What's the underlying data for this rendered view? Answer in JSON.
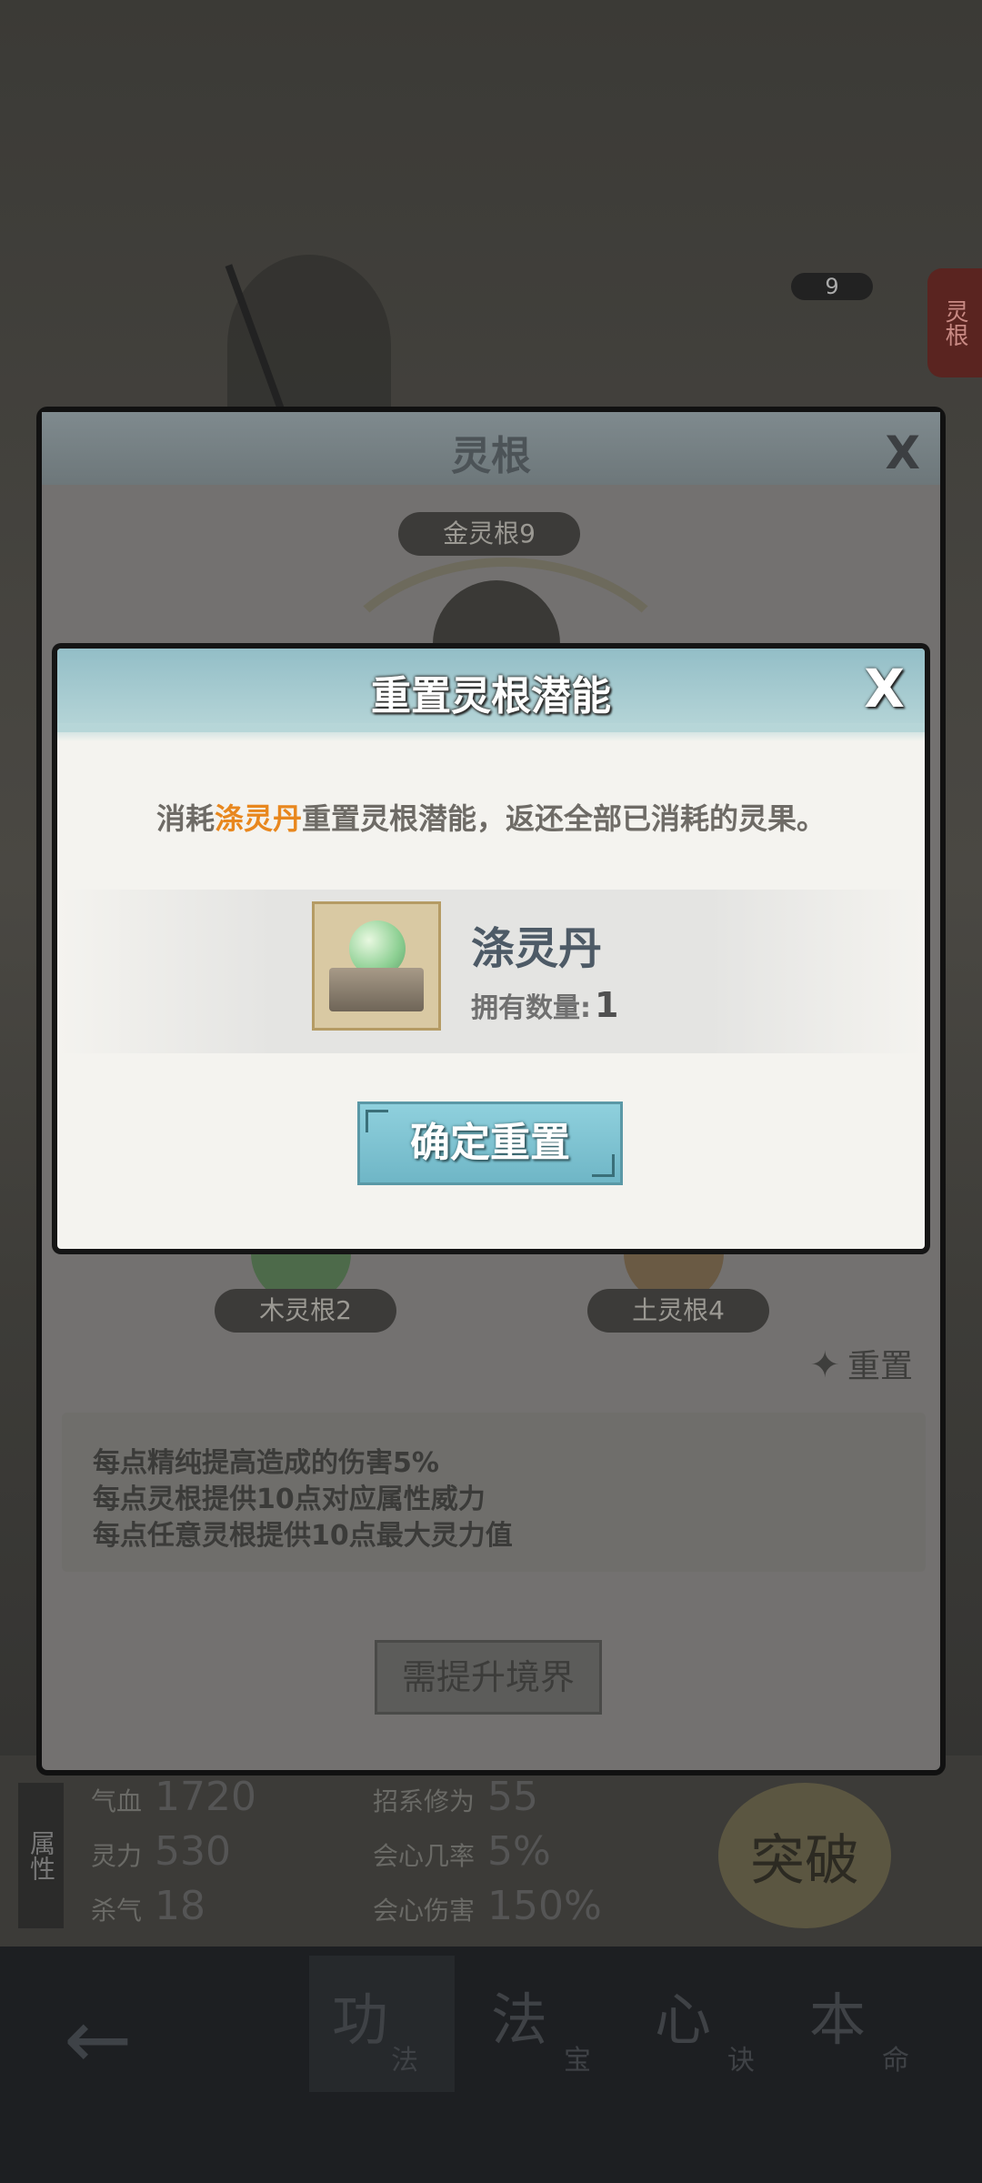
{
  "background": {
    "level": "9",
    "side_tab": "灵根",
    "stats_tab": "属性",
    "stats": [
      {
        "label": "气血",
        "value": "1720"
      },
      {
        "label": "招系修为",
        "value": "55"
      },
      {
        "label": "灵力",
        "value": "530"
      },
      {
        "label": "会心几率",
        "value": "5%"
      },
      {
        "label": "杀气",
        "value": "18"
      },
      {
        "label": "会心伤害",
        "value": "150%"
      }
    ],
    "breakthrough": "突破",
    "nav": [
      {
        "main": "功",
        "sub": "法"
      },
      {
        "main": "法",
        "sub": "宝"
      },
      {
        "main": "心",
        "sub": "诀"
      },
      {
        "main": "本",
        "sub": "命"
      }
    ]
  },
  "outer": {
    "title": "灵根",
    "close": "X",
    "gold_label": "金灵根9",
    "wood_label": "木灵根2",
    "earth_label": "土灵根4",
    "reset_link": "重置",
    "descriptions": [
      "每点精纯提高造成的伤害5%",
      "每点灵根提供10点对应属性威力",
      "每点任意灵根提供10点最大灵力值"
    ],
    "need_button": "需提升境界"
  },
  "dialog": {
    "title": "重置灵根潜能",
    "close": "X",
    "message_prefix": "消耗",
    "message_highlight": "涤灵丹",
    "message_suffix": "重置灵根潜能，返还全部已消耗的灵果。",
    "item": {
      "name": "涤灵丹",
      "count_label": "拥有数量:",
      "count": "1"
    },
    "confirm_button": "确定重置"
  },
  "colors": {
    "highlight": "#e8871e",
    "dialog_header": "#93bec7",
    "confirm_button": "#8fd0dd"
  }
}
